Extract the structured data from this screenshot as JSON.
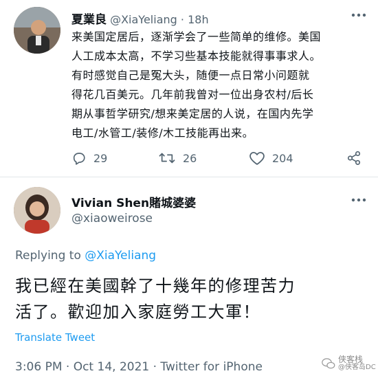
{
  "original_tweet": {
    "display_name": "夏業良",
    "handle": "@XiaYeliang",
    "separator": "·",
    "time": "18h",
    "text_lines": [
      "来美国定居后，逐渐学会了一些简单的维修。美国",
      "人工成本太高，不学习些基本技能就得事事求人。",
      "有时感觉自己是冤大头，随便一点日常小问题就",
      "得花几百美元。几年前我曾对一位出身农村/后长",
      "期从事哲学研究/想来美定居的人说，在国内先学",
      "电工/水管工/装修/木工技能再出来。"
    ],
    "actions": {
      "reply_count": "29",
      "retweet_count": "26",
      "like_count": "204"
    }
  },
  "reply_tweet": {
    "display_name": "Vivian Shen賭城婆婆",
    "handle": "@xiaoweirose",
    "replying_to_prefix": "Replying to",
    "replying_to_handle": "@XiaYeliang",
    "text_lines": [
      "我已經在美國幹了十幾年的修理苦力",
      "活了。歡迎加入家庭勞工大軍！"
    ],
    "translate_label": "Translate Tweet",
    "meta_line": "3:06 PM · Oct 14, 2021 · Twitter for iPhone"
  },
  "watermark": {
    "line1": "侠客栈",
    "line2": "@侠客岛DC"
  },
  "colors": {
    "link": "#1d9bf0",
    "secondary_text": "#536471",
    "primary_text": "#0f1419",
    "divider": "#e1e6ea"
  },
  "icons": [
    "reply-icon",
    "retweet-icon",
    "like-icon",
    "share-icon",
    "more-icon",
    "wechat-icon"
  ]
}
